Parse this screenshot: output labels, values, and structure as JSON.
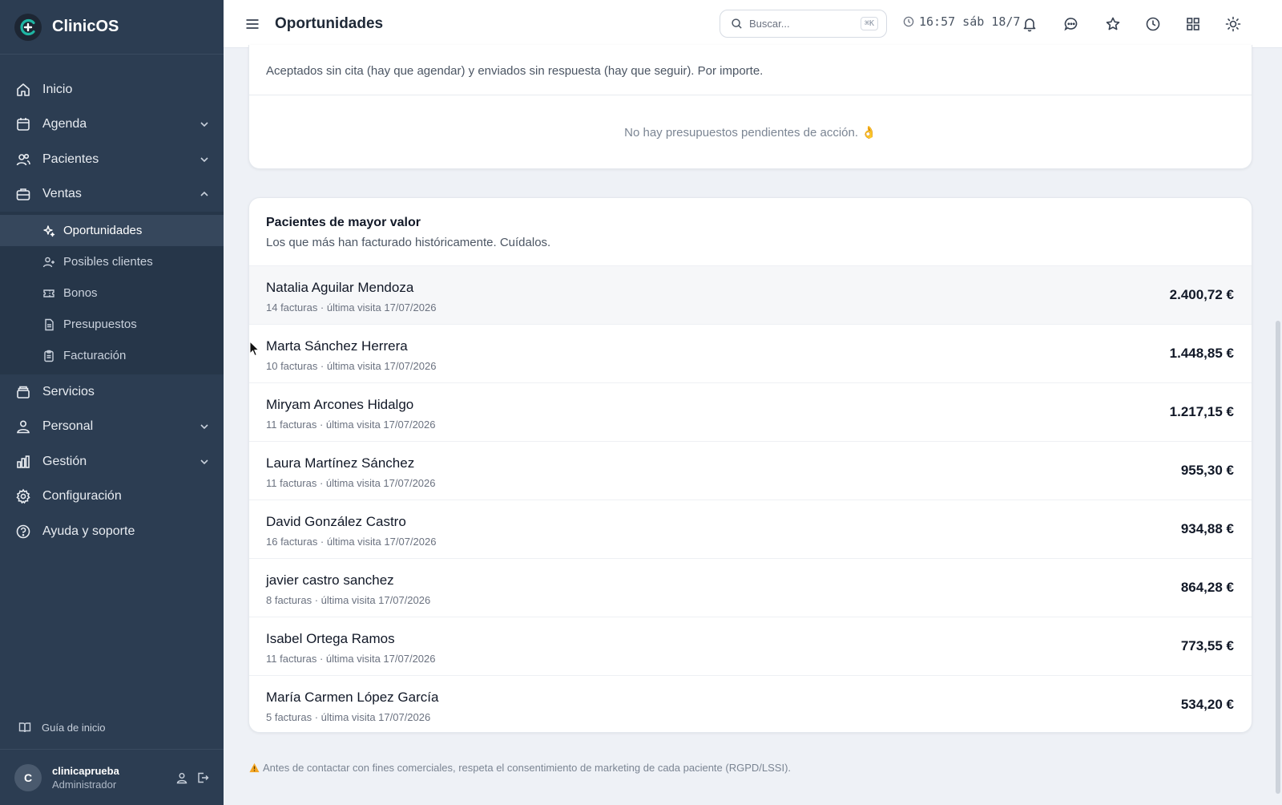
{
  "app": {
    "name": "ClinicOS"
  },
  "sidebar": {
    "items": [
      {
        "label": "Inicio",
        "icon": "home-icon"
      },
      {
        "label": "Agenda",
        "icon": "calendar-icon",
        "expandable": true
      },
      {
        "label": "Pacientes",
        "icon": "users-icon",
        "expandable": true
      },
      {
        "label": "Ventas",
        "icon": "briefcase-icon",
        "expandable": true,
        "expanded": true
      }
    ],
    "sales_subitems": [
      {
        "label": "Oportunidades",
        "icon": "sparkle-icon",
        "active": true
      },
      {
        "label": "Posibles clientes",
        "icon": "user-plus-icon"
      },
      {
        "label": "Bonos",
        "icon": "ticket-icon"
      },
      {
        "label": "Presupuestos",
        "icon": "document-icon"
      },
      {
        "label": "Facturación",
        "icon": "clipboard-icon"
      }
    ],
    "items_after": [
      {
        "label": "Servicios",
        "icon": "archive-icon"
      },
      {
        "label": "Personal",
        "icon": "staff-icon",
        "expandable": true
      },
      {
        "label": "Gestión",
        "icon": "bar-chart-icon",
        "expandable": true
      },
      {
        "label": "Configuración",
        "icon": "gear-icon"
      },
      {
        "label": "Ayuda y soporte",
        "icon": "help-icon"
      }
    ],
    "guide_label": "Guía de inicio",
    "user": {
      "initial": "C",
      "name": "clinicaprueba",
      "role": "Administrador"
    }
  },
  "topbar": {
    "title": "Oportunidades",
    "search_placeholder": "Buscar...",
    "search_shortcut": "⌘K",
    "clock": "16:57 sáb 18/7"
  },
  "pending_card": {
    "description": "Aceptados sin cita (hay que agendar) y enviados sin respuesta (hay que seguir). Por importe.",
    "empty_message": "No hay presupuestos pendientes de acción. 👌"
  },
  "top_patients": {
    "title": "Pacientes de mayor valor",
    "subtitle": "Los que más han facturado históricamente. Cuídalos.",
    "rows": [
      {
        "name": "Natalia Aguilar Mendoza",
        "meta": "14 facturas · última visita 17/07/2026",
        "amount": "2.400,72 €"
      },
      {
        "name": "Marta Sánchez Herrera",
        "meta": "10 facturas · última visita 17/07/2026",
        "amount": "1.448,85 €"
      },
      {
        "name": "Miryam Arcones Hidalgo",
        "meta": "11 facturas · última visita 17/07/2026",
        "amount": "1.217,15 €"
      },
      {
        "name": "Laura Martínez Sánchez",
        "meta": "11 facturas · última visita 17/07/2026",
        "amount": "955,30 €"
      },
      {
        "name": "David González Castro",
        "meta": "16 facturas · última visita 17/07/2026",
        "amount": "934,88 €"
      },
      {
        "name": "javier castro sanchez",
        "meta": "8 facturas · última visita 17/07/2026",
        "amount": "864,28 €"
      },
      {
        "name": "Isabel Ortega Ramos",
        "meta": "11 facturas · última visita 17/07/2026",
        "amount": "773,55 €"
      },
      {
        "name": "María Carmen López García",
        "meta": "5 facturas · última visita 17/07/2026",
        "amount": "534,20 €"
      }
    ]
  },
  "footer_note": "Antes de contactar con fines comerciales, respeta el consentimiento de marketing de cada paciente (RGPD/LSSI).",
  "colors": {
    "sidebar_bg": "#2c3d52",
    "accent": "#1fb5a3",
    "warning": "#f5a623"
  }
}
